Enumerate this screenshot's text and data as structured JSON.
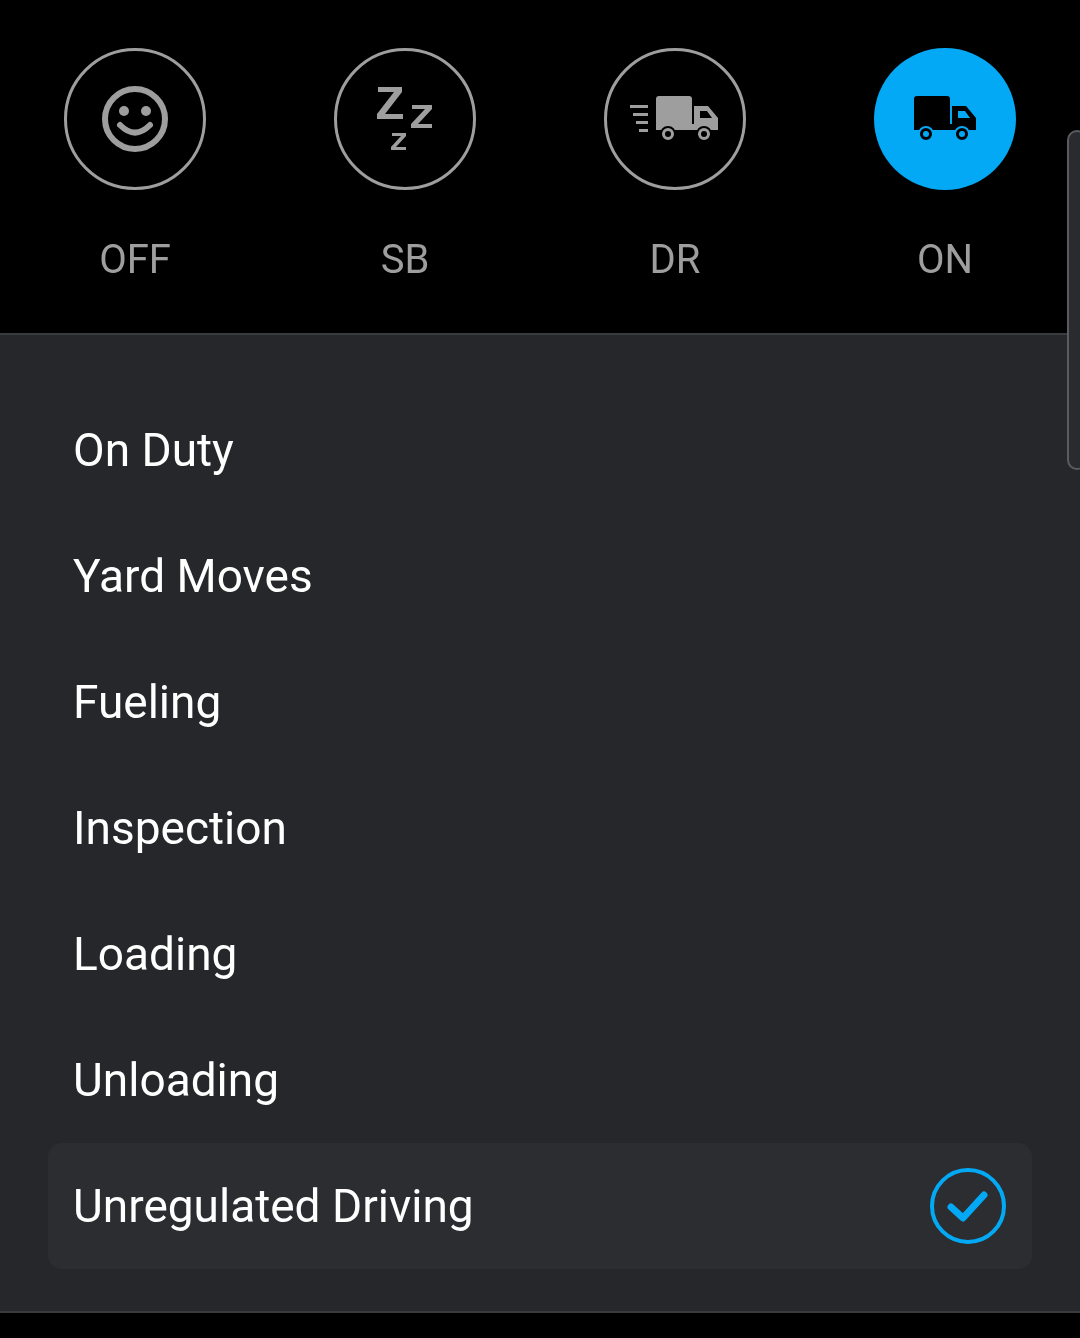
{
  "statuses": [
    {
      "kind": "off",
      "label": "OFF",
      "selected": false
    },
    {
      "kind": "sb",
      "label": "SB",
      "selected": false
    },
    {
      "kind": "dr",
      "label": "DR",
      "selected": false
    },
    {
      "kind": "on",
      "label": "ON",
      "selected": true
    }
  ],
  "options": [
    {
      "label": "On Duty",
      "selected": false
    },
    {
      "label": "Yard Moves",
      "selected": false
    },
    {
      "label": "Fueling",
      "selected": false
    },
    {
      "label": "Inspection",
      "selected": false
    },
    {
      "label": "Loading",
      "selected": false
    },
    {
      "label": "Unloading",
      "selected": false
    },
    {
      "label": "Unregulated Driving",
      "selected": true
    }
  ]
}
